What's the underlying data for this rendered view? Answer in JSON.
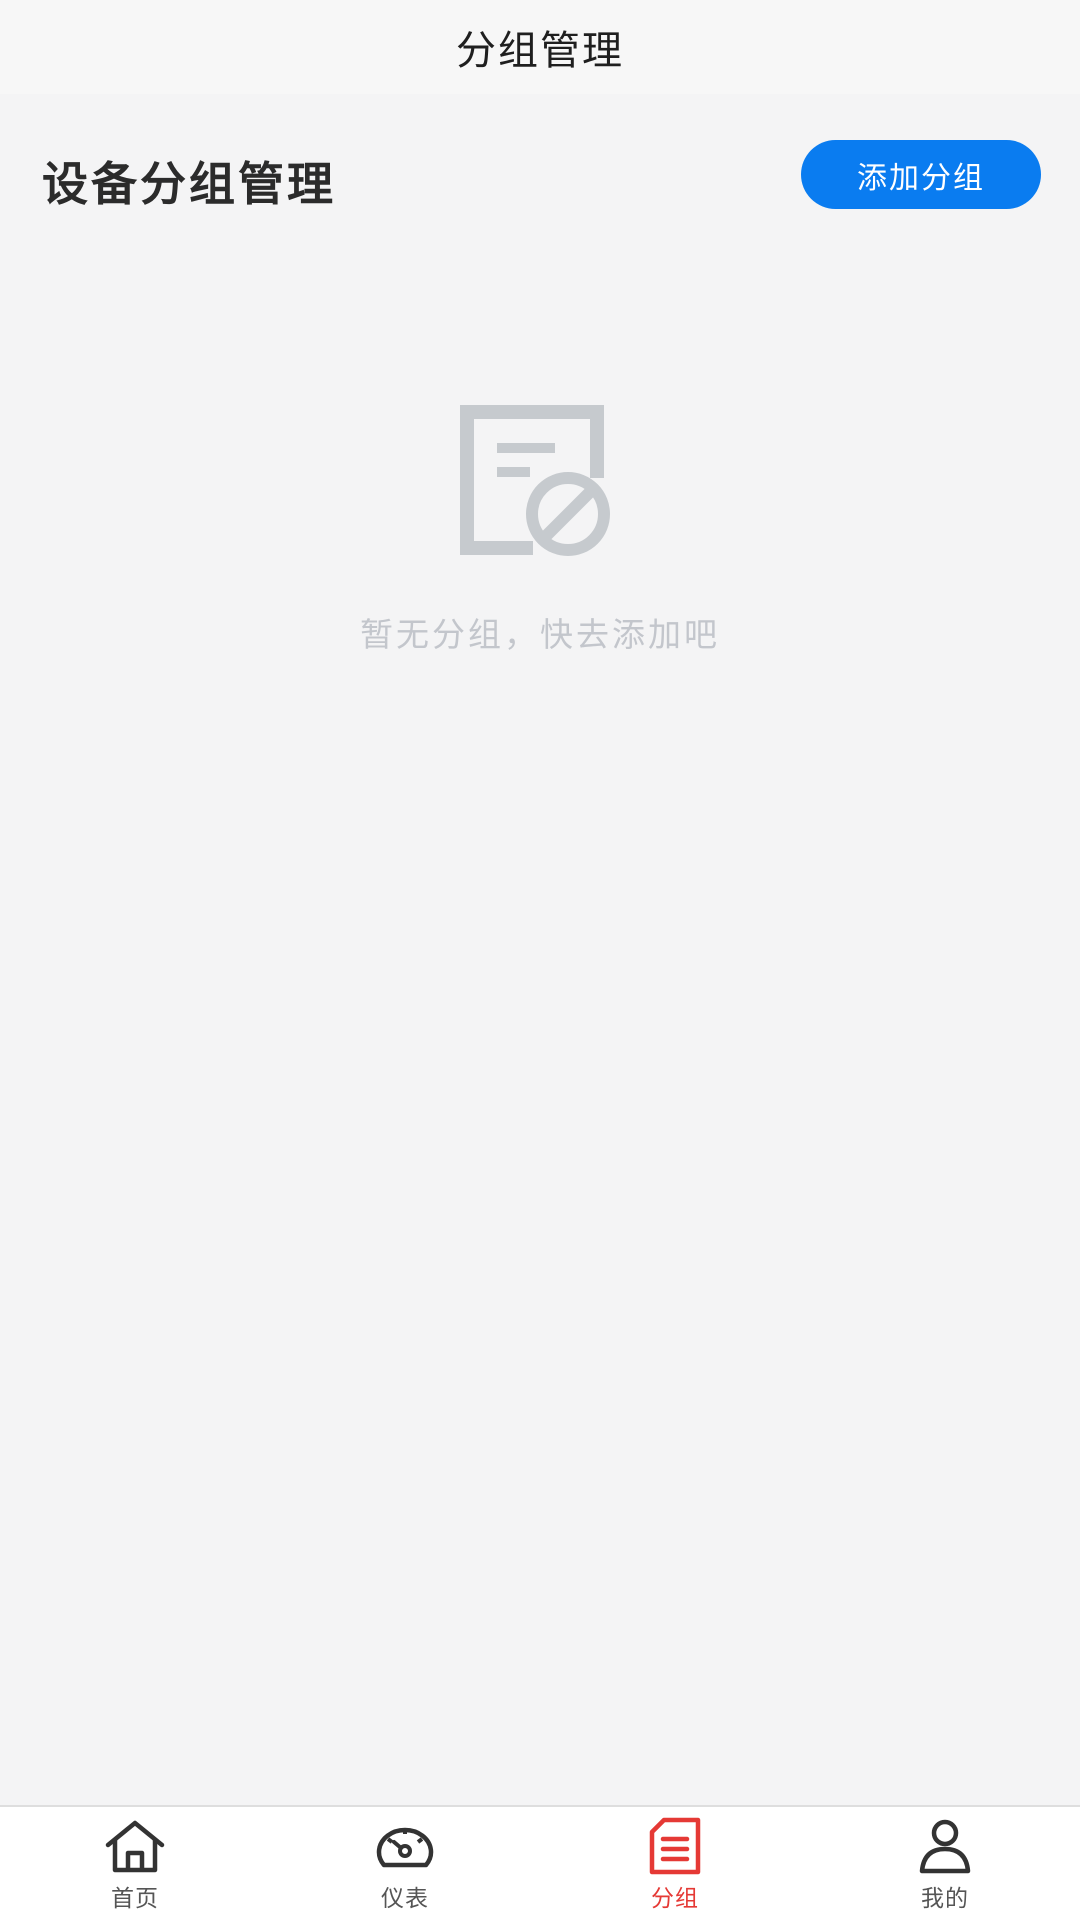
{
  "nav": {
    "title": "分组管理"
  },
  "header": {
    "title": "设备分组管理",
    "add_button_label": "添加分组"
  },
  "empty_state": {
    "icon": "document-disabled-icon",
    "message": "暂无分组，快去添加吧"
  },
  "tabs": [
    {
      "label": "首页",
      "icon": "home-icon",
      "active": false
    },
    {
      "label": "仪表",
      "icon": "gauge-icon",
      "active": false
    },
    {
      "label": "分组",
      "icon": "group-document-icon",
      "active": true
    },
    {
      "label": "我的",
      "icon": "user-icon",
      "active": false
    }
  ],
  "colors": {
    "accent": "#0a7cf0",
    "active_tab": "#e53935",
    "background": "#f4f4f5",
    "empty_text": "#c3c6cc"
  }
}
